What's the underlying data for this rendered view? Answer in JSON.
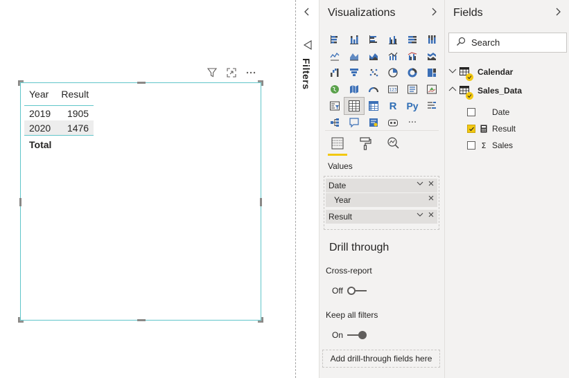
{
  "visual": {
    "columns": [
      "Year",
      "Result"
    ],
    "rows": [
      {
        "year": "2019",
        "result": "1905"
      },
      {
        "year": "2020",
        "result": "1476"
      }
    ],
    "total_label": "Total",
    "header_icons": [
      "filter-icon",
      "focus-mode-icon",
      "more-options-icon"
    ]
  },
  "filters": {
    "label": "Filters"
  },
  "visualizations": {
    "title": "Visualizations",
    "grid_icons": [
      "stacked-bar-chart",
      "stacked-column-chart",
      "clustered-bar-chart",
      "clustered-column-chart",
      "100-stacked-bar-chart",
      "100-stacked-column-chart",
      "line-chart",
      "area-chart",
      "stacked-area-chart",
      "line-and-stacked-column-chart",
      "line-and-clustered-column-chart",
      "ribbon-chart",
      "waterfall-chart",
      "funnel-chart",
      "scatter-chart",
      "pie-chart",
      "donut-chart",
      "treemap",
      "map",
      "filled-map",
      "gauge",
      "card",
      "multi-row-card",
      "kpi",
      "slicer",
      "table",
      "matrix",
      "r-script-visual",
      "python-visual",
      "key-influencers",
      "decomposition-tree",
      "qa-visual",
      "smart-narrative",
      "paginated-report",
      "more-visuals"
    ],
    "r_label": "R",
    "py_label": "Py",
    "more_label": "···",
    "values_label": "Values",
    "wells": [
      {
        "field": "Date",
        "child": "Year"
      },
      {
        "field": "Result"
      }
    ],
    "drill_through": {
      "title": "Drill through",
      "cross_report_label": "Cross-report",
      "cross_report_state": "Off",
      "keep_filters_label": "Keep all filters",
      "keep_filters_state": "On",
      "drop_zone": "Add drill-through fields here"
    }
  },
  "fields": {
    "title": "Fields",
    "search_placeholder": "Search",
    "tables": [
      {
        "name": "Calendar"
      },
      {
        "name": "Sales_Data",
        "items": [
          {
            "name": "Date",
            "checked": false
          },
          {
            "name": "Result",
            "checked": true
          },
          {
            "name": "Sales",
            "checked": false
          }
        ]
      }
    ]
  },
  "colors": {
    "accent": "#f2c811",
    "selection_border": "#5fc5c9",
    "pane_bg": "#f3f2f1"
  }
}
